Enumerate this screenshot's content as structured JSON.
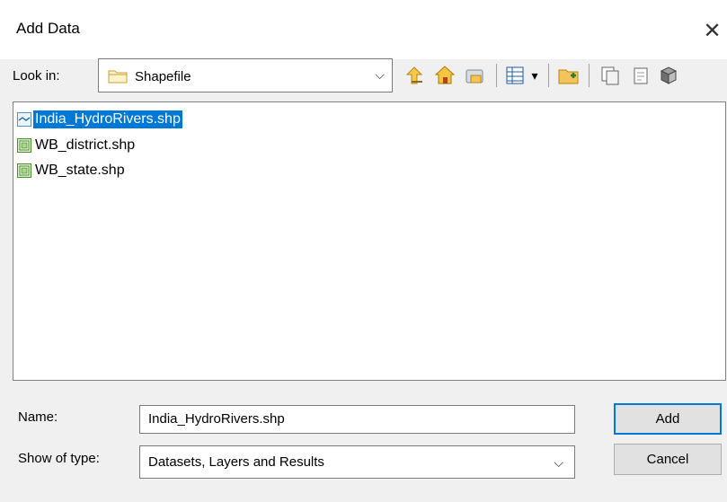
{
  "window": {
    "title": "Add Data",
    "close_glyph": "✕"
  },
  "lookin": {
    "label": "Look in:",
    "value": "Shapefile",
    "chevron": "⌵"
  },
  "toolbar": {
    "icons": [
      "up-one-level-icon",
      "home-icon",
      "connect-to-folder-icon",
      "list-view-icon",
      "new-folder-icon",
      "copy-icon",
      "new-item-icon",
      "database-icon"
    ],
    "view_dropdown_glyph": "▾"
  },
  "files": [
    {
      "name": "India_HydroRivers.shp",
      "type": "line-shapefile",
      "selected": true
    },
    {
      "name": "WB_district.shp",
      "type": "polygon-shapefile",
      "selected": false
    },
    {
      "name": "WB_state.shp",
      "type": "polygon-shapefile",
      "selected": false
    }
  ],
  "form": {
    "name_label": "Name:",
    "name_value": "India_HydroRivers.shp",
    "type_label": "Show of type:",
    "type_value": "Datasets, Layers and Results",
    "type_chevron": "⌵"
  },
  "buttons": {
    "add": "Add",
    "cancel": "Cancel"
  },
  "colors": {
    "selection": "#0078d7",
    "background": "#f0f0f0"
  }
}
